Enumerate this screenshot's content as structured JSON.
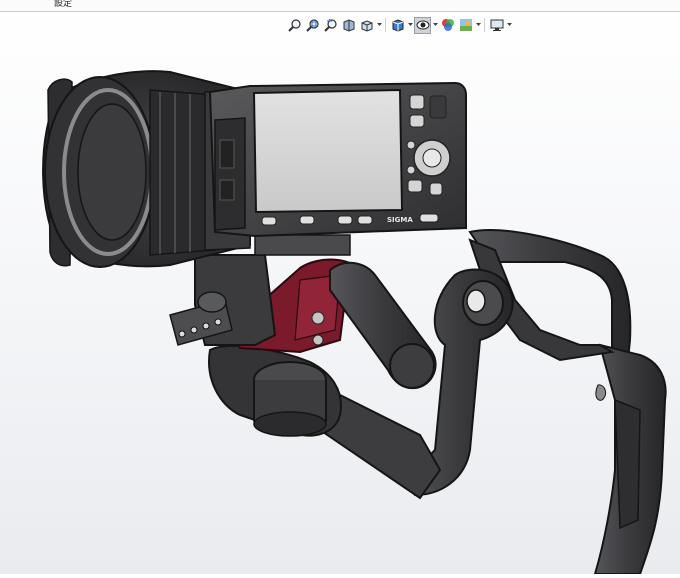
{
  "topbar": {
    "label": "設定"
  },
  "toolbar": {
    "items": [
      {
        "name": "zoom-to-fit-icon",
        "dropdown": false
      },
      {
        "name": "zoom-to-area-icon",
        "dropdown": false
      },
      {
        "name": "previous-view-icon",
        "dropdown": false
      },
      {
        "name": "section-view-icon",
        "dropdown": false
      },
      {
        "name": "view-orientation-icon",
        "dropdown": true
      },
      {
        "name": "display-style-icon",
        "dropdown": true
      },
      {
        "name": "hide-show-items-icon",
        "dropdown": true,
        "active": true
      },
      {
        "name": "edit-appearance-icon",
        "dropdown": false
      },
      {
        "name": "apply-scene-icon",
        "dropdown": true
      },
      {
        "name": "view-settings-icon",
        "dropdown": true
      }
    ]
  },
  "model": {
    "camera_brand": "SIGMA",
    "colors": {
      "body": "#3b3b3d",
      "screen": "#d8d8d8",
      "accent": "#7b1a2a",
      "edge": "#151515"
    }
  }
}
